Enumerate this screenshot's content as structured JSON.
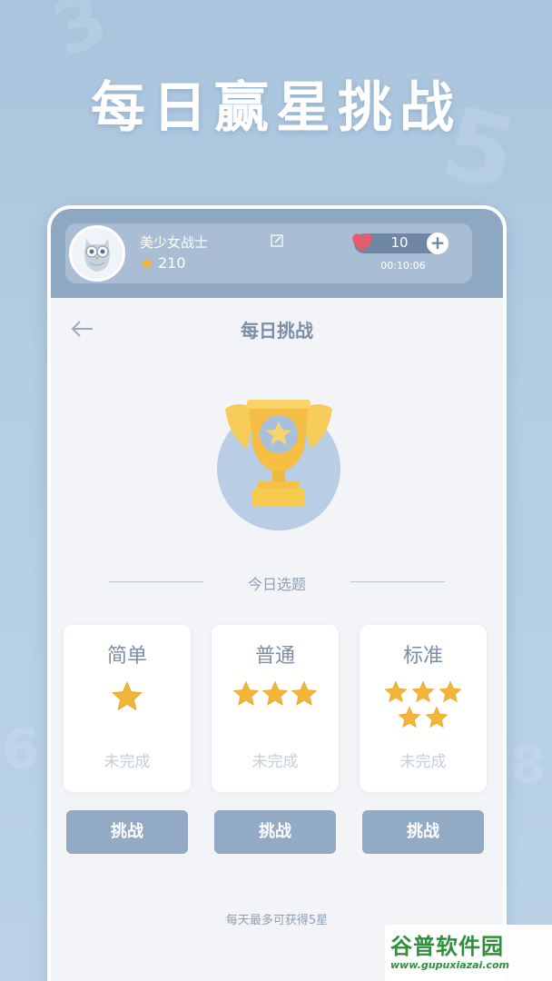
{
  "headline": "每日赢星挑战",
  "profile": {
    "username": "美少女战士",
    "score": "210",
    "lives": "10",
    "timer": "00:10:06"
  },
  "page": {
    "title": "每日挑战",
    "section_label": "今日选题",
    "footnote": "每天最多可获得5星"
  },
  "levels": [
    {
      "title": "简单",
      "stars": 1,
      "status": "未完成",
      "button": "挑战"
    },
    {
      "title": "普通",
      "stars": 3,
      "status": "未完成",
      "button": "挑战"
    },
    {
      "title": "标准",
      "stars": 5,
      "status": "未完成",
      "button": "挑战"
    }
  ],
  "watermark": {
    "main": "谷普软件园",
    "sub": "www.gupuxiazai.com"
  },
  "colors": {
    "background": "#b3cde3",
    "header": "#8fa8c2",
    "button": "#93aac5",
    "star": "#f2b53a",
    "heart": "#e35d6a"
  },
  "icons": [
    "owl-avatar-icon",
    "edit-icon",
    "star-icon",
    "heart-icon",
    "plus-icon",
    "back-arrow-icon",
    "trophy-icon"
  ]
}
